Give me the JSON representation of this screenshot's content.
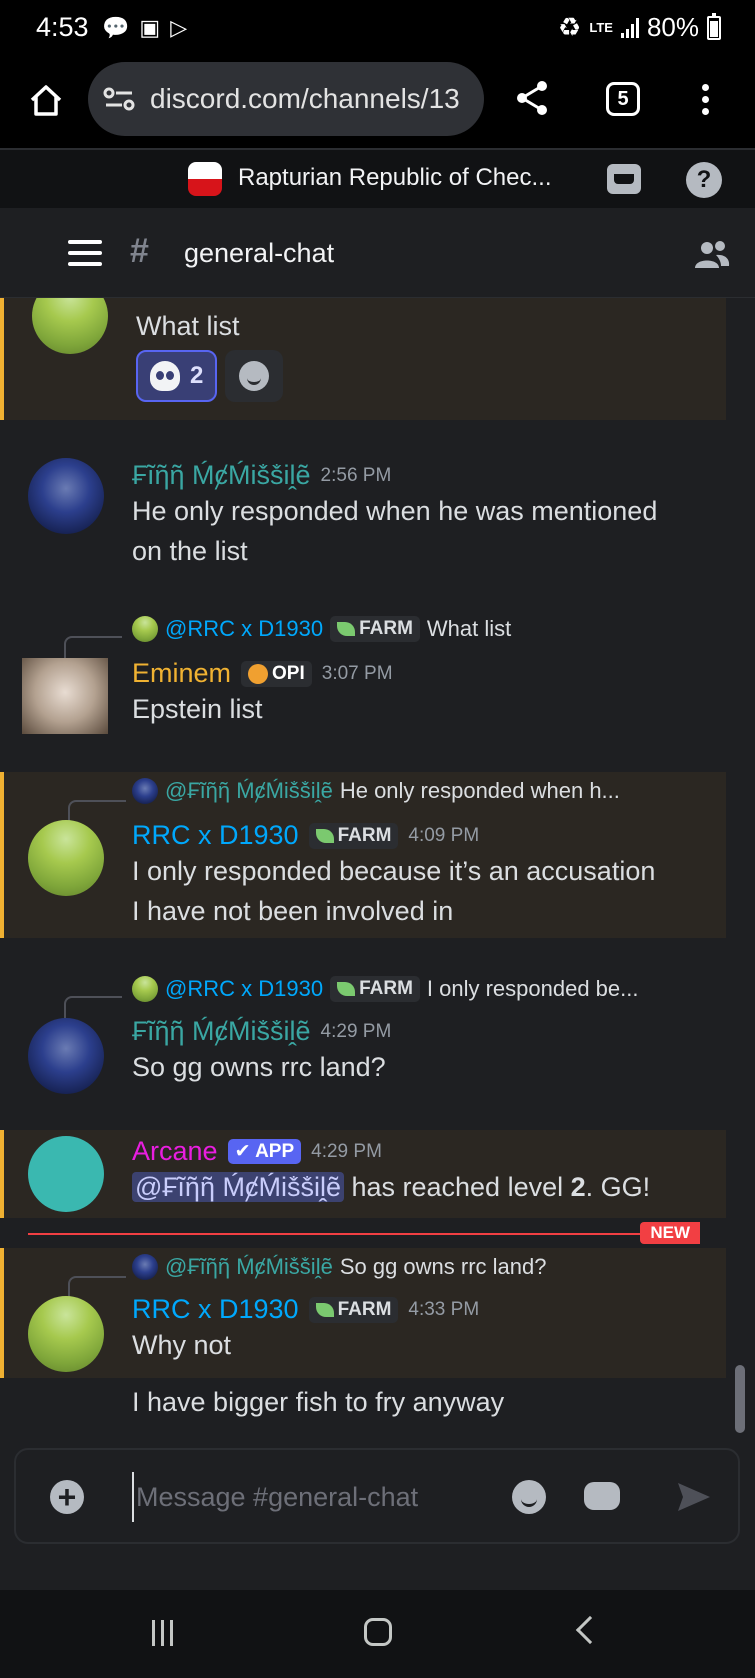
{
  "status_bar": {
    "time": "4:53",
    "network": "LTE",
    "battery": "80%"
  },
  "browser": {
    "url": "discord.com/channels/13",
    "tab_count": "5"
  },
  "server": {
    "name": "Rapturian Republic of Chec..."
  },
  "channel": {
    "name": "general-chat"
  },
  "messages": [
    {
      "partial_top": true,
      "text": "What list",
      "reactions": [
        {
          "emoji": "skull-icon",
          "count": "2"
        }
      ]
    },
    {
      "author": "₣ĩῆῆ ḾȼḾiṧṧiḽẽ",
      "time": "2:56 PM",
      "text_lines": [
        "He only responded when he was mentioned",
        "on the list"
      ]
    },
    {
      "reply": {
        "mention": "@RRC x D1930",
        "tag": "FARM",
        "snippet": "What list"
      },
      "author": "Eminem",
      "tag": "OPI",
      "time": "3:07 PM",
      "text": "Epstein list"
    },
    {
      "reply": {
        "mention": "@₣ĩῆῆ ḾȼḾiṧṧiḽẽ",
        "snippet": "He only responded when h..."
      },
      "author": "RRC x D1930",
      "tag": "FARM",
      "time": "4:09 PM",
      "text_lines": [
        "I only responded because it’s an accusation",
        "I have not been involved in"
      ]
    },
    {
      "reply": {
        "mention": "@RRC x D1930",
        "tag": "FARM",
        "snippet": "I only responded be..."
      },
      "author": "₣ĩῆῆ ḾȼḾiṧṧiḽẽ",
      "time": "4:29 PM",
      "text": "So gg owns rrc land?"
    },
    {
      "author": "Arcane",
      "tag": "APP",
      "time": "4:29 PM",
      "mention": "@₣ĩῆῆ ḾȼḾiṧṧiḽẽ",
      "text_before": " has reached level ",
      "level": "2",
      "text_after": ". GG!"
    },
    {
      "reply": {
        "mention": "@₣ĩῆῆ ḾȼḾiṧṧiḽẽ",
        "snippet": "So gg owns rrc land?"
      },
      "author": "RRC x D1930",
      "tag": "FARM",
      "time": "4:33 PM",
      "text_lines": [
        "Why not",
        "I have bigger fish to fry anyway"
      ]
    }
  ],
  "new_divider": "NEW",
  "composer": {
    "placeholder": "Message #general-chat"
  },
  "colors": {
    "accent": "#5865f2",
    "mention_highlight": "#f0b132",
    "new_red": "#f23f43",
    "rrc_blue": "#00a8fc",
    "finn_teal": "#3aa7a3",
    "eminem_gold": "#f0b232",
    "arcane_magenta": "#e91ee0"
  }
}
